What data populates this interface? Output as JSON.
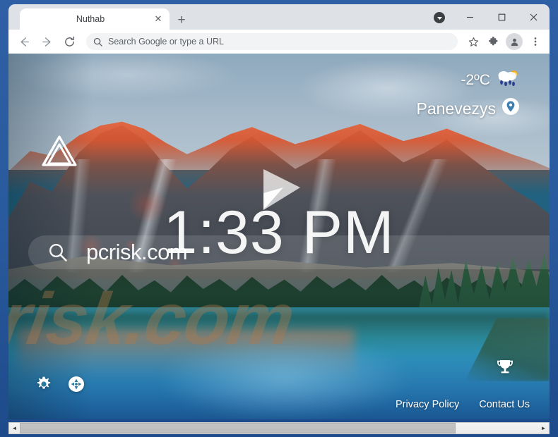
{
  "browser": {
    "tab": {
      "title": "Nuthab",
      "close_label": "✕"
    },
    "newtab_label": "+",
    "window_controls": {
      "minimize": "─",
      "maximize": "□",
      "close": "✕"
    },
    "nav": {
      "back": "back-arrow",
      "forward": "forward-arrow",
      "reload": "reload"
    },
    "omnibox": {
      "placeholder": "Search Google or type a URL",
      "value": "Search Google or type a URL",
      "icon": "search-icon"
    },
    "toolbar_icons": [
      "bookmark-star-icon",
      "extensions-puzzle-icon",
      "profile-avatar-icon",
      "three-dot-menu-icon"
    ]
  },
  "newtab": {
    "logo": "nuthab-triangle-logo",
    "weather": {
      "temperature": "-2ºС",
      "icon": "rain-cloud-sun-icon",
      "location": "Panevezys",
      "location_icon": "location-pin-icon"
    },
    "play_button": "play-triangle-icon",
    "clock": "1:33 PM",
    "search": {
      "value": "pcrisk.com",
      "icon": "search-magnifier-icon"
    },
    "watermark": "risk.com",
    "bottom_tools": [
      {
        "name": "settings-gear-icon",
        "label": "Settings"
      },
      {
        "name": "fullscreen-expand-icon",
        "label": "Fullscreen"
      }
    ],
    "trophy_icon": "trophy-cup-icon",
    "links": [
      {
        "label": "Privacy Policy"
      },
      {
        "label": "Contact Us"
      }
    ]
  },
  "scrollbar": {
    "left_arrow": "◄",
    "right_arrow": "►",
    "thumb_percent": 84
  },
  "colors": {
    "frame_blue": "#2a5a9e",
    "tabstrip": "#dee1e6",
    "toolbar_white": "#ffffff",
    "omnibox_gray": "#f1f3f4",
    "text_dark": "#3c4043",
    "accent_white": "#ffffff",
    "watermark": "#af784b"
  }
}
